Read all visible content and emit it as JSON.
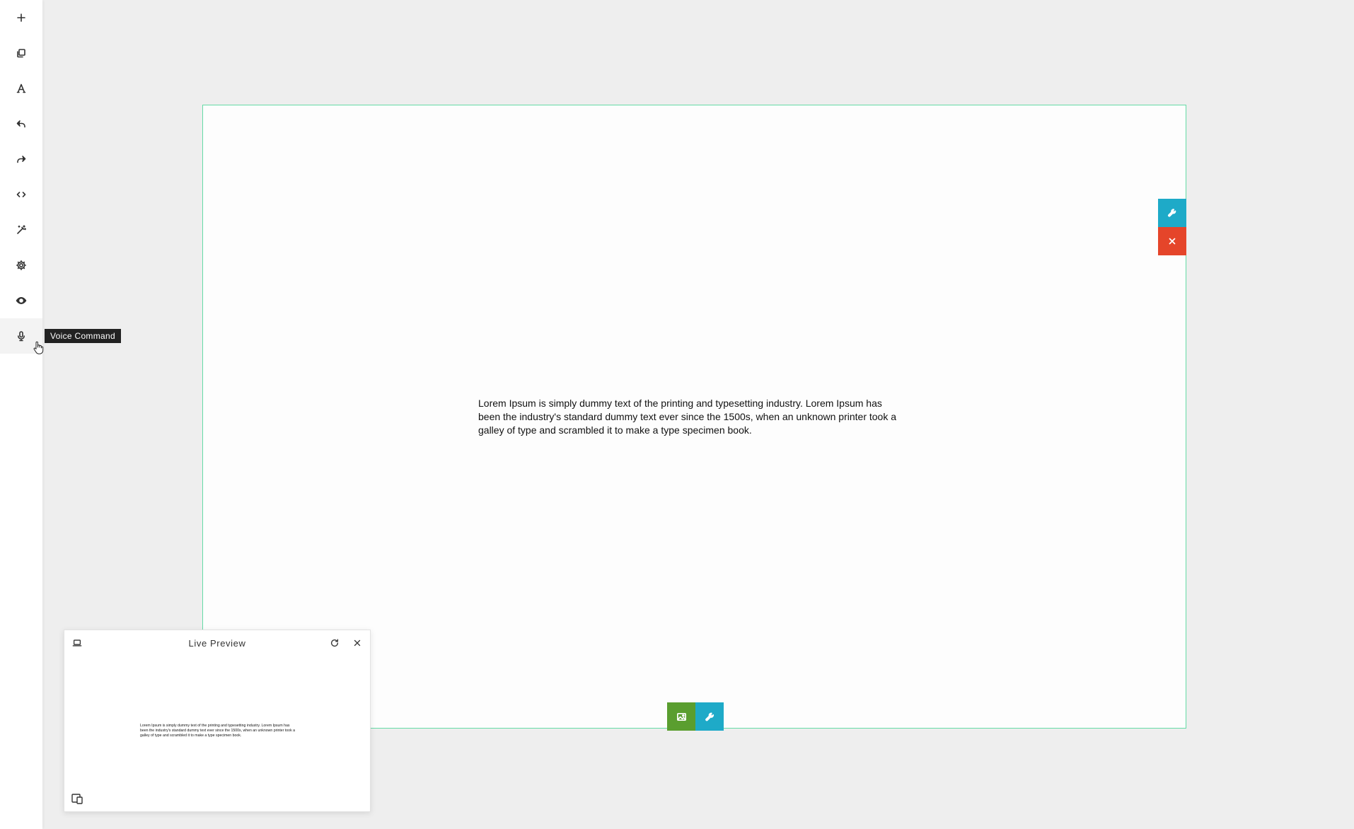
{
  "toolbar": {
    "items": [
      {
        "name": "add",
        "icon": "plus-icon"
      },
      {
        "name": "layers",
        "icon": "copy-icon"
      },
      {
        "name": "typography",
        "icon": "font-icon"
      },
      {
        "name": "undo",
        "icon": "undo-icon"
      },
      {
        "name": "redo",
        "icon": "redo-icon"
      },
      {
        "name": "code",
        "icon": "code-icon"
      },
      {
        "name": "magic",
        "icon": "magic-wand-icon"
      },
      {
        "name": "settings",
        "icon": "gear-icon"
      },
      {
        "name": "preview",
        "icon": "eye-icon"
      },
      {
        "name": "voice",
        "icon": "microphone-icon"
      }
    ],
    "tooltip": "Voice Command"
  },
  "canvas": {
    "text": "Lorem Ipsum is simply dummy text of the printing and typesetting industry. Lorem Ipsum has been the industry's standard dummy text ever since the 1500s, when an unknown printer took a galley of type and scrambled it to make a type specimen book.",
    "accent_border": "#65dba6",
    "side_actions": [
      {
        "name": "settings",
        "icon": "wrench-icon",
        "color": "#1eaac8"
      },
      {
        "name": "delete",
        "icon": "close-icon",
        "color": "#e5452a"
      }
    ],
    "bottom_actions": [
      {
        "name": "image",
        "icon": "image-icon",
        "color": "#5a9e2f"
      },
      {
        "name": "settings",
        "icon": "wrench-icon",
        "color": "#1eaac8"
      }
    ]
  },
  "preview": {
    "title": "Live Preview",
    "text": "Lorem Ipsum is simply dummy text of the printing and typesetting industry. Lorem Ipsum has been the industry's standard dummy text ever since the 1500s, when an unknown printer took a galley of type and scrambled it to make a type specimen book."
  }
}
